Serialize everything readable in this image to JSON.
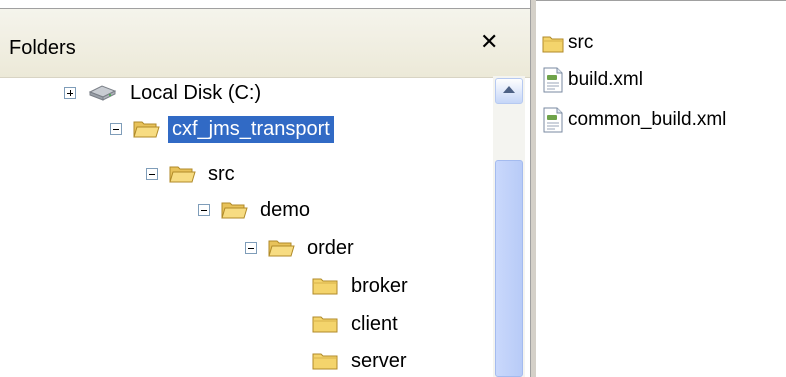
{
  "folders_pane": {
    "title": "Folders",
    "close_symbol": "✕"
  },
  "tree": [
    {
      "label": "Local Disk (C:)",
      "icon": "disk-icon",
      "expander": "plus",
      "selected": false
    },
    {
      "label": "cxf_jms_transport",
      "icon": "folder-open-icon",
      "expander": "minus",
      "selected": true
    },
    {
      "label": "src",
      "icon": "folder-open-icon",
      "expander": "minus",
      "selected": false
    },
    {
      "label": "demo",
      "icon": "folder-open-icon",
      "expander": "minus",
      "selected": false
    },
    {
      "label": "order",
      "icon": "folder-open-icon",
      "expander": "minus",
      "selected": false
    },
    {
      "label": "broker",
      "icon": "folder-icon",
      "expander": "none",
      "selected": false
    },
    {
      "label": "client",
      "icon": "folder-icon",
      "expander": "none",
      "selected": false
    },
    {
      "label": "server",
      "icon": "folder-icon",
      "expander": "none",
      "selected": false
    }
  ],
  "files": [
    {
      "label": "src",
      "icon": "folder-icon"
    },
    {
      "label": "build.xml",
      "icon": "xml-file-icon"
    },
    {
      "label": "common_build.xml",
      "icon": "xml-file-icon"
    }
  ],
  "colors": {
    "selection": "#316ac5",
    "folder_yellow": "#f4d46c"
  }
}
